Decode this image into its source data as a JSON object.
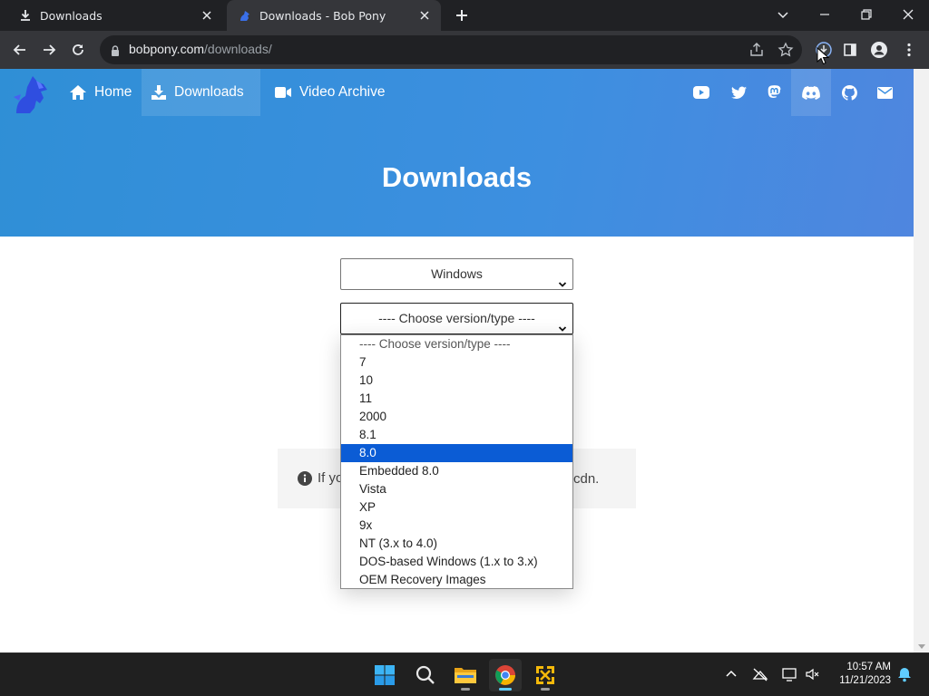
{
  "browser": {
    "tabs": [
      {
        "title": "Downloads",
        "active": false
      },
      {
        "title": "Downloads - Bob Pony",
        "active": true
      }
    ],
    "url_host": "bobpony.com",
    "url_path": "/downloads/"
  },
  "site": {
    "nav": [
      {
        "label": "Home",
        "icon": "home-icon"
      },
      {
        "label": "Downloads",
        "icon": "download-icon"
      },
      {
        "label": "Video Archive",
        "icon": "video-camera-icon"
      }
    ],
    "social_icons": [
      "youtube-icon",
      "twitter-icon",
      "mastodon-icon",
      "discord-icon",
      "github-icon",
      "email-icon"
    ],
    "hero_title": "Downloads",
    "os_select": {
      "value": "Windows"
    },
    "version_select": {
      "value": "---- Choose version/type ----",
      "options": [
        "---- Choose version/type ----",
        "7",
        "10",
        "11",
        "2000",
        "8.1",
        "8.0",
        "Embedded 8.0",
        "Vista",
        "XP",
        "9x",
        "NT (3.x to 4.0)",
        "DOS-based Windows (1.x to 3.x)",
        "OEM Recovery Images"
      ],
      "highlighted": "8.0"
    },
    "info_prefix": "If yo",
    "info_suffix": "cdn."
  },
  "taskbar": {
    "apps": [
      "windows-start-icon",
      "search-icon",
      "file-explorer-icon",
      "chrome-icon",
      "app-icon"
    ],
    "time": "10:57 AM",
    "date": "11/21/2023"
  },
  "colors": {
    "hero_start": "#2f8fd6",
    "hero_end": "#4f86df",
    "selection": "#0b5cd5"
  }
}
